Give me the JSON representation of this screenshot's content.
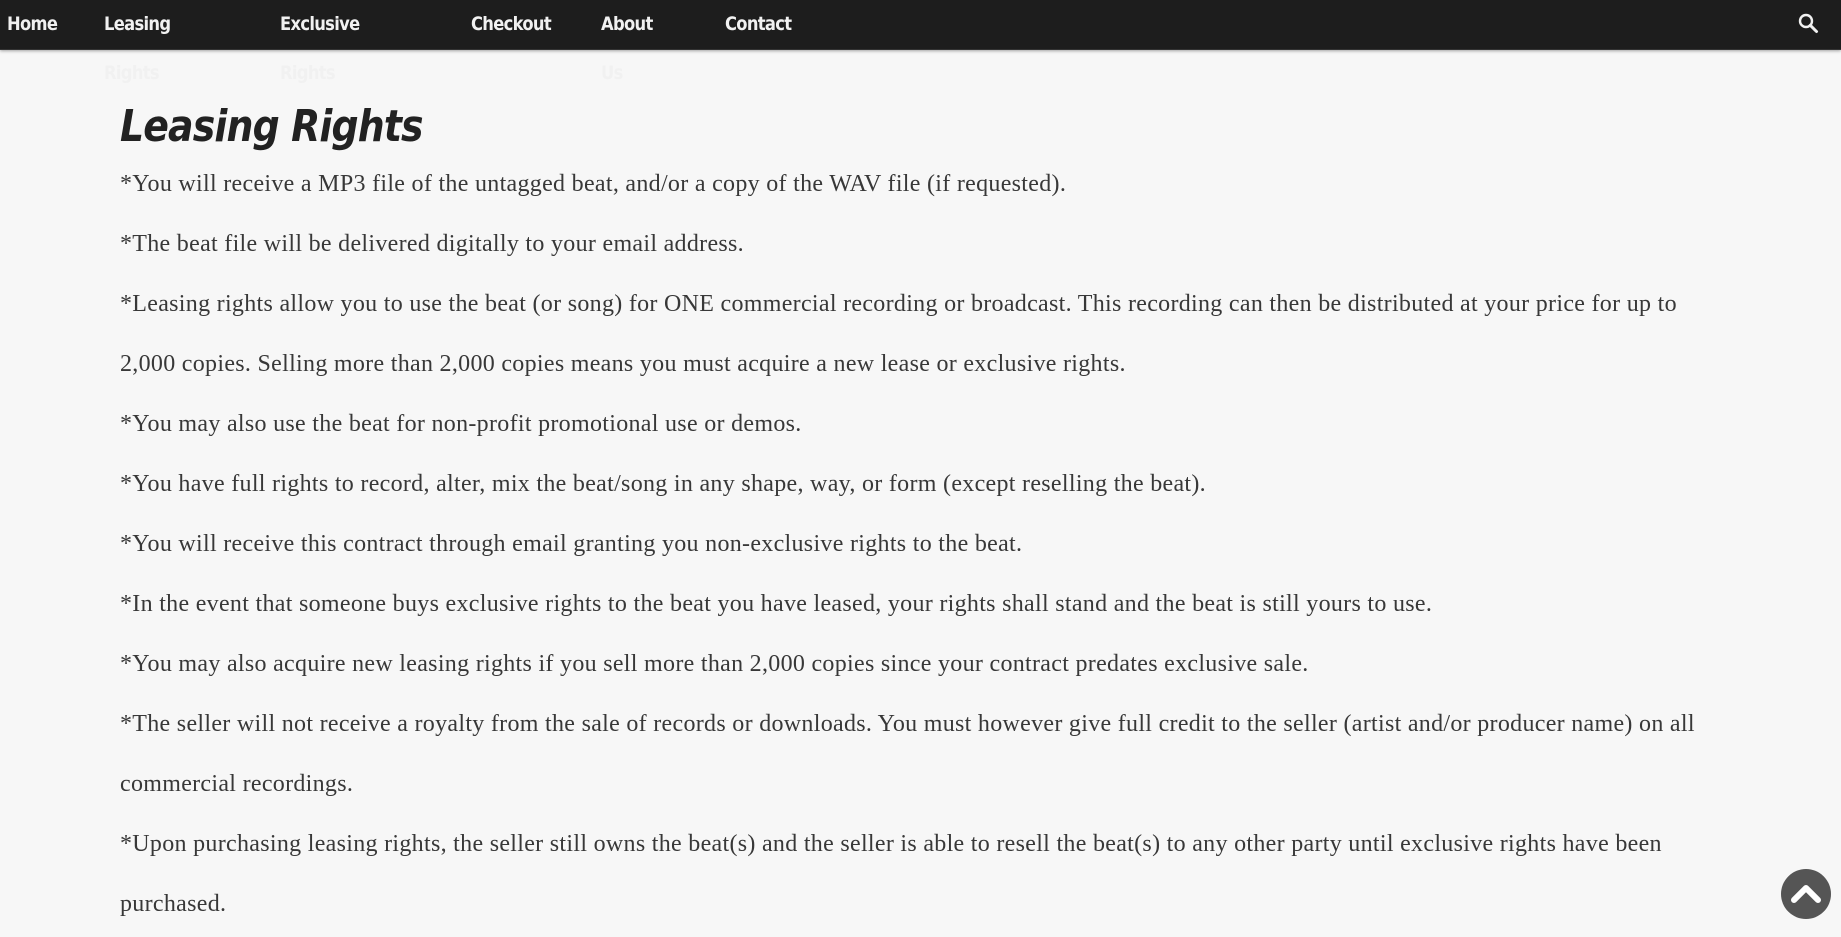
{
  "nav": {
    "items": [
      {
        "label": "Home"
      },
      {
        "label": "Leasing Rights"
      },
      {
        "label": "Exclusive Rights"
      },
      {
        "label": "Checkout"
      },
      {
        "label": "About Us"
      },
      {
        "label": "Contact"
      }
    ],
    "search_icon": "search-icon"
  },
  "page": {
    "title": "Leasing Rights",
    "paragraphs": [
      "*You will receive a MP3 file of the untagged beat, and/or a copy of the WAV file (if requested).",
      "*The beat file will be delivered digitally to your email address.",
      "*Leasing rights allow you to use the beat (or song) for ONE commercial recording or broadcast. This recording can then be distributed at your price for up to 2,000 copies. Selling more than 2,000 copies means you must acquire a new lease or exclusive rights.",
      "*You may also use the beat for non-profit promotional use or demos.",
      "*You have full rights to record, alter, mix the beat/song in any shape, way, or form (except reselling the beat).",
      "*You will receive this contract through email granting you non-exclusive rights to the beat.",
      "*In the event that someone buys exclusive rights to the beat you have leased, your rights shall stand and the beat is still yours to use.",
      "*You may also acquire new leasing rights if you sell more than 2,000 copies since your contract predates exclusive sale.",
      "*The seller will not receive a royalty from the sale of records or downloads. You must however give full credit to the seller (artist and/or producer name) on all commercial recordings.",
      "*Upon purchasing leasing rights, the seller still owns the beat(s) and the seller is able to resell the beat(s) to any other party until exclusive rights have been purchased."
    ]
  },
  "scroll_top": {
    "icon": "chevron-up-icon"
  },
  "colors": {
    "nav_background": "#1d1d1d",
    "nav_text": "#f1f1f1",
    "page_background": "#f7f7f7",
    "body_text": "#383838",
    "scroll_button": "#555555"
  }
}
